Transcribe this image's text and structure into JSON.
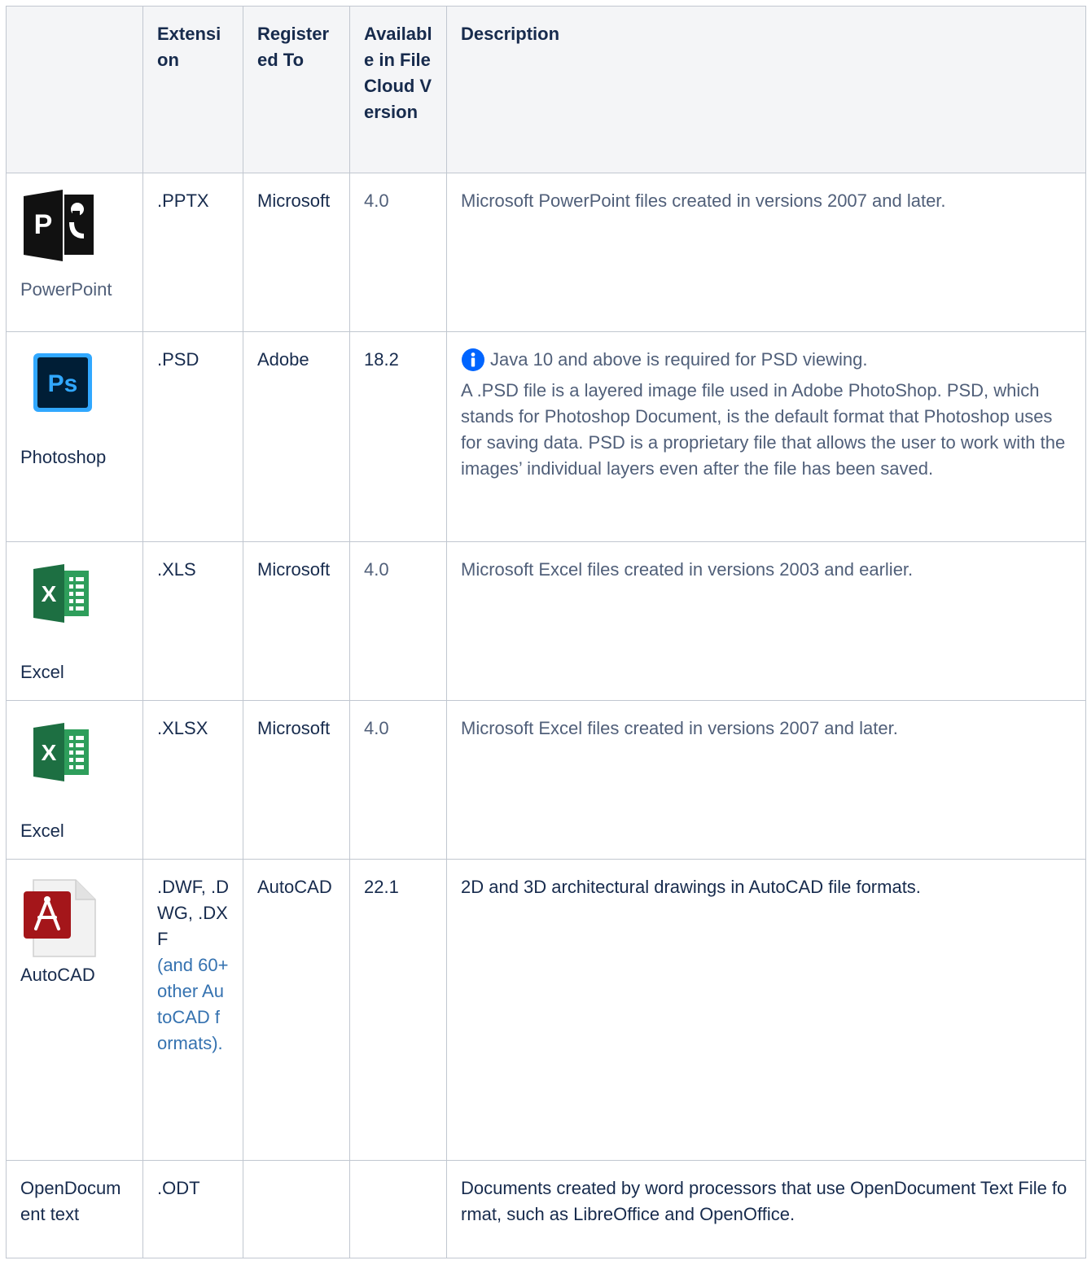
{
  "table": {
    "headers": {
      "icon": "",
      "extension": "Extension",
      "registered_to": "Registered To",
      "available": "Available in FileCloud Version",
      "description": "Description"
    },
    "rows": [
      {
        "name": "PowerPoint",
        "icon": "powerpoint-icon",
        "extension": ".PPTX",
        "registered_to": "Microsoft",
        "version": "4.0",
        "description": "Microsoft PowerPoint files created in versions 2007 and later."
      },
      {
        "name": "Photoshop",
        "icon": "photoshop-icon",
        "extension": ".PSD",
        "registered_to": "Adobe",
        "version": "18.2",
        "info_note": "Java 10 and above is required for PSD viewing.",
        "description": "A .PSD file is a layered image file used in Adobe PhotoShop. PSD, which stands for Photoshop Document, is the default format that Photoshop uses for saving data. PSD is a proprietary file that allows the user to work with the images’ individual layers even after the file has been saved."
      },
      {
        "name": "Excel",
        "icon": "excel-icon",
        "extension": ".XLS",
        "registered_to": "Microsoft",
        "version": "4.0",
        "description": "Microsoft Excel files created in versions 2003 and earlier."
      },
      {
        "name": "Excel",
        "icon": "excel-icon",
        "extension": ".XLSX",
        "registered_to": "Microsoft",
        "version": "4.0",
        "description": "Microsoft Excel files created in versions 2007 and later."
      },
      {
        "name": "AutoCAD",
        "icon": "autocad-icon",
        "extension": ".DWF, .DWG, .DXF",
        "extension_link": "(and 60+ other AutoCAD formats).",
        "registered_to": "AutoCAD",
        "version": "22.1",
        "description": "2D and 3D architectural drawings in AutoCAD file formats."
      },
      {
        "name": "OpenDocument text",
        "extension": ".ODT",
        "registered_to": "",
        "version": "",
        "description": "Documents created by word processors that use OpenDocument Text File format, such as LibreOffice and OpenOffice."
      }
    ]
  },
  "colors": {
    "header_bg": "#f4f5f7",
    "border": "#c1c7d0",
    "link": "#3572b0",
    "info_blue": "#0065ff",
    "photoshop_blue": "#31a8ff",
    "photoshop_bg": "#001e36",
    "excel_green": "#1d6f42",
    "autocad_red": "#a4161a"
  }
}
